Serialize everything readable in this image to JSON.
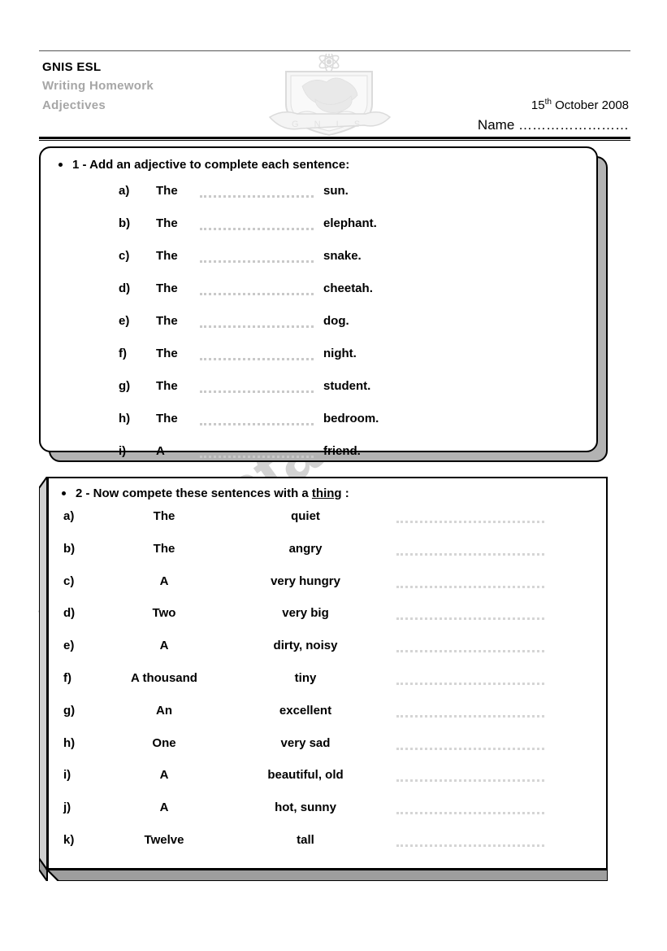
{
  "header": {
    "title": "GNIS ESL",
    "subtitle1": "Writing Homework",
    "subtitle2": "Adjectives",
    "date_day": "15",
    "date_suffix": "th",
    "date_rest": " October 2008",
    "name_label": "Name ……………………",
    "crest_text": "G N I S"
  },
  "watermark": {
    "text": "ESLprintables.com"
  },
  "exercise1": {
    "bullet": "•",
    "heading": "1 - Add an adjective to complete each sentence:",
    "rows": [
      {
        "letter": "a)",
        "determiner": "The",
        "noun": "sun."
      },
      {
        "letter": "b)",
        "determiner": "The",
        "noun": "elephant."
      },
      {
        "letter": "c)",
        "determiner": "The",
        "noun": "snake."
      },
      {
        "letter": "d)",
        "determiner": "The",
        "noun": "cheetah."
      },
      {
        "letter": "e)",
        "determiner": "The",
        "noun": "dog."
      },
      {
        "letter": "f)",
        "determiner": "The",
        "noun": "night."
      },
      {
        "letter": "g)",
        "determiner": "The",
        "noun": "student."
      },
      {
        "letter": "h)",
        "determiner": "The",
        "noun": "bedroom."
      },
      {
        "letter": "i)",
        "determiner": "A",
        "noun": "friend."
      }
    ]
  },
  "exercise2": {
    "bullet": "•",
    "heading_before": "2 - Now compete these sentences with a ",
    "heading_underlined": "thing",
    "heading_after": " :",
    "rows": [
      {
        "letter": "a)",
        "determiner": "The",
        "adjective": "quiet"
      },
      {
        "letter": "b)",
        "determiner": "The",
        "adjective": "angry"
      },
      {
        "letter": "c)",
        "determiner": "A",
        "adjective": "very hungry"
      },
      {
        "letter": "d)",
        "determiner": "Two",
        "adjective": "very big"
      },
      {
        "letter": "e)",
        "determiner": "A",
        "adjective": "dirty, noisy"
      },
      {
        "letter": "f)",
        "determiner": "A thousand",
        "adjective": "tiny"
      },
      {
        "letter": "g)",
        "determiner": "An",
        "adjective": "excellent"
      },
      {
        "letter": "h)",
        "determiner": "One",
        "adjective": "very sad"
      },
      {
        "letter": "i)",
        "determiner": "A",
        "adjective": "beautiful, old"
      },
      {
        "letter": "j)",
        "determiner": "A",
        "adjective": "hot, sunny"
      },
      {
        "letter": "k)",
        "determiner": "Twelve",
        "adjective": "tall"
      }
    ]
  },
  "colors": {
    "subtitle_gray": "#a6a6a6",
    "watermark_gray": "#d2d2d2",
    "shadow_gray": "#b3b3b3",
    "blank_dot_gray": "#c9c9c9"
  }
}
